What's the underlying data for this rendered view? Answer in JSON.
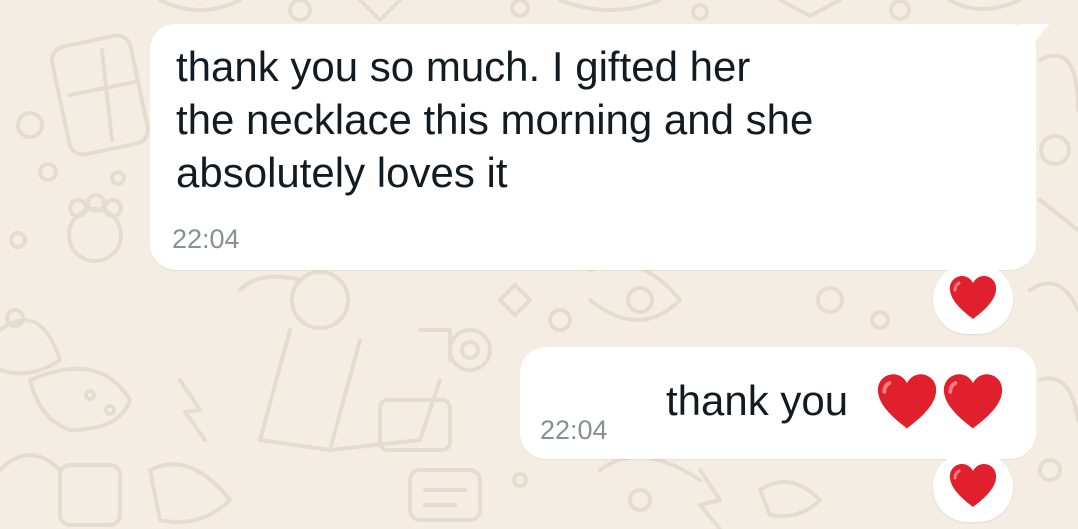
{
  "messages": [
    {
      "direction": "incoming",
      "text": "thank you so much. I gifted her\nthe necklace this morning and she\nabsolutely loves it",
      "time": "22:04",
      "reaction": "red-heart"
    },
    {
      "direction": "outgoing",
      "text": "thank you",
      "emoji": [
        "red-heart",
        "red-heart"
      ],
      "time": "22:04",
      "reaction": "red-heart"
    }
  ],
  "colors": {
    "wallpaper": "#f4ede4",
    "doodle": "#e6dccd",
    "bubble": "#ffffff",
    "text": "#111b21",
    "time": "#8a8f92",
    "heart": "#e0202c"
  }
}
